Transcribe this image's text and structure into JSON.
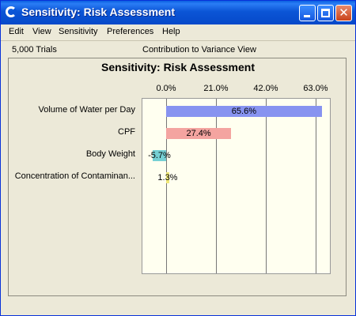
{
  "window": {
    "title": "Sensitivity: Risk Assessment"
  },
  "menu": [
    "Edit",
    "View",
    "Sensitivity",
    "Preferences",
    "Help"
  ],
  "info": {
    "trials": "5,000 Trials",
    "view": "Contribution to Variance View"
  },
  "chart_data": {
    "type": "bar",
    "orientation": "horizontal",
    "title": "Sensitivity: Risk Assessment",
    "categories": [
      "Volume of Water per Day",
      "CPF",
      "Body Weight",
      "Concentration of Contaminan..."
    ],
    "values": [
      65.6,
      27.4,
      -5.7,
      1.3
    ],
    "value_labels": [
      "65.6%",
      "27.4%",
      "-5.7%",
      "1.3%"
    ],
    "ticks": [
      "0.0%",
      "21.0%",
      "42.0%",
      "63.0%"
    ],
    "tick_values": [
      0,
      21,
      42,
      63
    ],
    "xlim": [
      -10,
      69
    ],
    "grid": true,
    "colors": [
      "#8793f0",
      "#f4a4a0",
      "#76d0d4",
      "#f0e878"
    ]
  }
}
